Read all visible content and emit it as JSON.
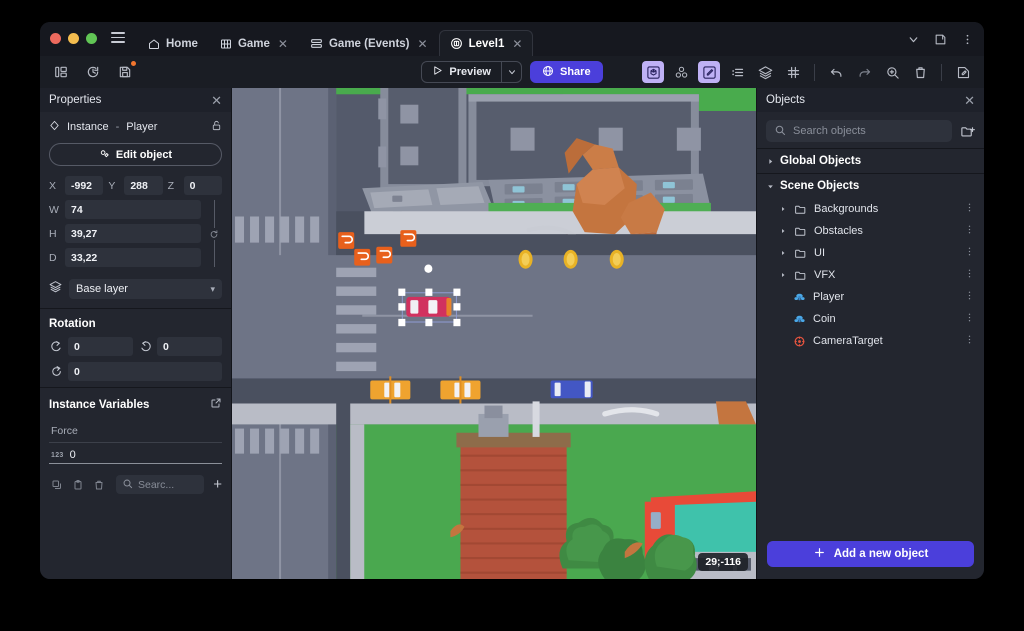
{
  "window": {
    "traffic_lights": [
      "close",
      "minimize",
      "maximize"
    ],
    "menu_icon": "hamburger-icon",
    "right_controls": [
      "chevron-down-icon",
      "panel-layout-icon",
      "more-vertical-icon"
    ]
  },
  "tabs": [
    {
      "label": "Home",
      "icon": "home-icon",
      "closable": false,
      "active": false
    },
    {
      "label": "Game",
      "icon": "film-grid-icon",
      "closable": true,
      "active": false
    },
    {
      "label": "Game (Events)",
      "icon": "events-list-icon",
      "closable": true,
      "active": false
    },
    {
      "label": "Level1",
      "icon": "scene-circle-icon",
      "closable": true,
      "active": true
    }
  ],
  "toolbar": {
    "left_icons": [
      {
        "name": "panels-layout-icon"
      },
      {
        "name": "history-clock-icon"
      },
      {
        "name": "save-icon",
        "badge": true
      }
    ],
    "preview_label": "Preview",
    "preview_icon": "play-icon",
    "preview_caret_icon": "chevron-down-icon",
    "share_label": "Share",
    "share_icon": "globe-icon",
    "right_icons": [
      {
        "name": "cube-3d-icon",
        "active": true
      },
      {
        "name": "objects-group-icon",
        "active": false
      },
      {
        "name": "pencil-edit-icon",
        "active": true
      },
      {
        "name": "properties-list-icon",
        "active": false
      },
      {
        "name": "layers-icon",
        "active": false
      },
      {
        "name": "grid-icon",
        "active": false
      },
      {
        "name": "undo-icon",
        "active": false
      },
      {
        "name": "redo-icon",
        "active": false
      },
      {
        "name": "zoom-icon",
        "active": false
      },
      {
        "name": "trash-icon",
        "active": false
      },
      {
        "name": "edit-panel-icon",
        "active": false
      }
    ],
    "accent_color": "#4b3fdb",
    "active_icon_bg": "#bfb1f5"
  },
  "properties": {
    "title": "Properties",
    "close_icon": "close-icon",
    "instance_icon": "diamond-icon",
    "instance_label": "Instance",
    "separator": "-",
    "instance_name": "Player",
    "lock_icon": "lock-open-icon",
    "edit_object_label": "Edit object",
    "edit_object_icon": "edit-object-icon",
    "transform": {
      "x_label": "X",
      "x_value": "-992",
      "y_label": "Y",
      "y_value": "288",
      "z_label": "Z",
      "z_value": "0",
      "w_label": "W",
      "w_value": "74",
      "h_label": "H",
      "h_value": "39,27",
      "d_label": "D",
      "d_value": "33,22",
      "link_icon": "link-ratio-icon"
    },
    "layer": {
      "icon": "layers-icon",
      "value": "Base layer",
      "caret_icon": "chevron-down-icon"
    },
    "rotation": {
      "title": "Rotation",
      "x_icon": "rotate-x-icon",
      "x_value": "0",
      "y_icon": "rotate-y-icon",
      "y_value": "0",
      "z_icon": "rotate-z-icon",
      "z_value": "0"
    },
    "instance_variables": {
      "title": "Instance Variables",
      "open_icon": "external-link-icon",
      "variable_name": "Force",
      "variable_type_badge": "123",
      "variable_value": "0",
      "tool_icons": [
        "copy-icon",
        "paste-icon",
        "delete-icon"
      ],
      "search_placeholder": "Searc...",
      "search_icon": "search-icon",
      "add_icon": "plus-icon"
    }
  },
  "viewport": {
    "coordinates": "29;-116",
    "selected_object": "Player",
    "scene_colors": {
      "road": "#6e7486",
      "road_dark": "#545a6b",
      "sidewalk": "#b9bcc6",
      "grass": "#4aa84f",
      "building_grey": "#5c616e",
      "rock_orange": "#c4753f",
      "brick_red": "#b4523c",
      "tree_green": "#3f8a43",
      "selection": "#ffffff",
      "marker_orange": "#e8601c"
    }
  },
  "objects": {
    "title": "Objects",
    "close_icon": "close-icon",
    "search_placeholder": "Search objects",
    "search_icon": "search-icon",
    "new_folder_icon": "new-folder-icon",
    "global_group": {
      "label": "Global Objects",
      "expanded": false
    },
    "scene_group": {
      "label": "Scene Objects",
      "expanded": true
    },
    "items": [
      {
        "label": "Backgrounds",
        "type": "folder",
        "icon": "folder-icon",
        "expanded": false
      },
      {
        "label": "Obstacles",
        "type": "folder",
        "icon": "folder-icon",
        "expanded": false
      },
      {
        "label": "UI",
        "type": "folder",
        "icon": "folder-icon",
        "expanded": false
      },
      {
        "label": "VFX",
        "type": "folder",
        "icon": "folder-icon",
        "expanded": false
      },
      {
        "label": "Player",
        "type": "object",
        "icon": "object-blue-icon"
      },
      {
        "label": "Coin",
        "type": "object",
        "icon": "object-blue-icon"
      },
      {
        "label": "CameraTarget",
        "type": "object",
        "icon": "camera-target-red-icon"
      }
    ],
    "row_menu_icon": "more-vertical-icon",
    "add_label": "Add a new object",
    "add_icon": "plus-icon"
  }
}
